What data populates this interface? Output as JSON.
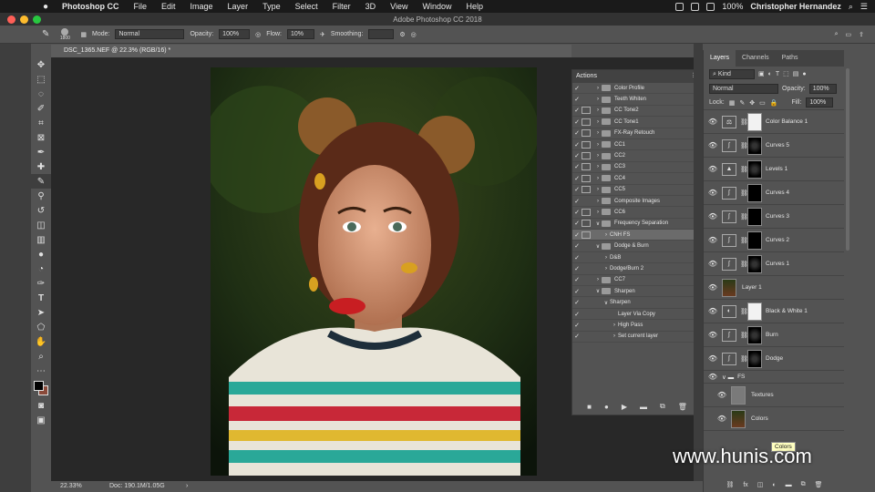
{
  "menubar": {
    "app": "Photoshop CC",
    "items": [
      "File",
      "Edit",
      "Image",
      "Layer",
      "Type",
      "Select",
      "Filter",
      "3D",
      "View",
      "Window",
      "Help"
    ],
    "battery": "100%",
    "user": "Christopher Hernandez"
  },
  "window": {
    "title": "Adobe Photoshop CC 2018"
  },
  "options": {
    "brush_size": "1800",
    "mode_label": "Mode:",
    "mode_value": "Normal",
    "opacity_label": "Opacity:",
    "opacity_value": "100%",
    "flow_label": "Flow:",
    "flow_value": "10%",
    "smoothing_label": "Smoothing:"
  },
  "document": {
    "tab": "DSC_1365.NEF @ 22.3% (RGB/16) *"
  },
  "status": {
    "zoom": "22.33%",
    "doc": "Doc: 190.1M/1.05G"
  },
  "actions_panel": {
    "title": "Actions",
    "rows": [
      {
        "label": "Color Profile",
        "dlg": false,
        "type": "folder",
        "indent": 0
      },
      {
        "label": "Teeth Whiten",
        "dlg": false,
        "type": "folder",
        "indent": 0
      },
      {
        "label": "CC Tone2",
        "dlg": true,
        "type": "folder",
        "indent": 0
      },
      {
        "label": "CC Tone1",
        "dlg": true,
        "type": "folder",
        "indent": 0
      },
      {
        "label": "FX-Ray Retouch",
        "dlg": true,
        "type": "folder",
        "indent": 0
      },
      {
        "label": "CC1",
        "dlg": true,
        "type": "folder",
        "indent": 0
      },
      {
        "label": "CC2",
        "dlg": true,
        "type": "folder",
        "indent": 0
      },
      {
        "label": "CC3",
        "dlg": true,
        "type": "folder",
        "indent": 0
      },
      {
        "label": "CC4",
        "dlg": true,
        "type": "folder",
        "indent": 0
      },
      {
        "label": "CC5",
        "dlg": true,
        "type": "folder",
        "indent": 0
      },
      {
        "label": "Composite Images",
        "dlg": false,
        "type": "folder",
        "indent": 0
      },
      {
        "label": "CC6",
        "dlg": true,
        "type": "folder",
        "indent": 0
      },
      {
        "label": "Frequency Separation",
        "dlg": true,
        "type": "folder-open",
        "indent": 0
      },
      {
        "label": "CNH FS",
        "dlg": true,
        "type": "action",
        "indent": 1,
        "selected": true
      },
      {
        "label": "Dodge & Burn",
        "dlg": false,
        "type": "folder-open",
        "indent": 0
      },
      {
        "label": "D&B",
        "dlg": false,
        "type": "action",
        "indent": 1
      },
      {
        "label": "Dodge/Burn 2",
        "dlg": false,
        "type": "action",
        "indent": 1
      },
      {
        "label": "CC7",
        "dlg": false,
        "type": "folder",
        "indent": 0
      },
      {
        "label": "Sharpen",
        "dlg": false,
        "type": "folder-open",
        "indent": 0
      },
      {
        "label": "Sharpen",
        "dlg": false,
        "type": "action-open",
        "indent": 1
      },
      {
        "label": "Layer Via Copy",
        "dlg": false,
        "type": "step",
        "indent": 2
      },
      {
        "label": "High Pass",
        "dlg": false,
        "type": "step-closed",
        "indent": 2
      },
      {
        "label": "Set current layer",
        "dlg": false,
        "type": "step-closed",
        "indent": 2
      }
    ],
    "footer_icons": [
      "stop-icon",
      "record-icon",
      "play-icon",
      "new-set-icon",
      "new-action-icon",
      "delete-icon"
    ]
  },
  "layers_panel": {
    "tabs": [
      "Layers",
      "Channels",
      "Paths"
    ],
    "filter_value": "Kind",
    "blend_mode": "Normal",
    "opacity_label": "Opacity:",
    "opacity_value": "100%",
    "lock_label": "Lock:",
    "fill_label": "Fill:",
    "fill_value": "100%",
    "layers": [
      {
        "name": "Color Balance 1",
        "kind": "adjust",
        "icon": "⚖",
        "mask": "white"
      },
      {
        "name": "Curves 5",
        "kind": "adjust",
        "icon": "∫",
        "mask": "dark"
      },
      {
        "name": "Levels 1",
        "kind": "adjust",
        "icon": "▲",
        "mask": "dark"
      },
      {
        "name": "Curves 4",
        "kind": "adjust",
        "icon": "∫",
        "mask": "black"
      },
      {
        "name": "Curves 3",
        "kind": "adjust",
        "icon": "∫",
        "mask": "black"
      },
      {
        "name": "Curves 2",
        "kind": "adjust",
        "icon": "∫",
        "mask": "black"
      },
      {
        "name": "Curves 1",
        "kind": "adjust",
        "icon": "∫",
        "mask": "dark"
      },
      {
        "name": "Layer 1",
        "kind": "pixel"
      },
      {
        "name": "Black & White 1",
        "kind": "adjust",
        "icon": "◐",
        "mask": "white"
      },
      {
        "name": "Burn",
        "kind": "adjust",
        "icon": "∫",
        "mask": "dark"
      },
      {
        "name": "Dodge",
        "kind": "adjust",
        "icon": "∫",
        "mask": "dark"
      },
      {
        "name": "FS",
        "kind": "group"
      },
      {
        "name": "Textures",
        "kind": "gray"
      },
      {
        "name": "Colors",
        "kind": "pixel"
      }
    ],
    "tooltip": "Colors"
  },
  "watermark": "www.hunis.com"
}
